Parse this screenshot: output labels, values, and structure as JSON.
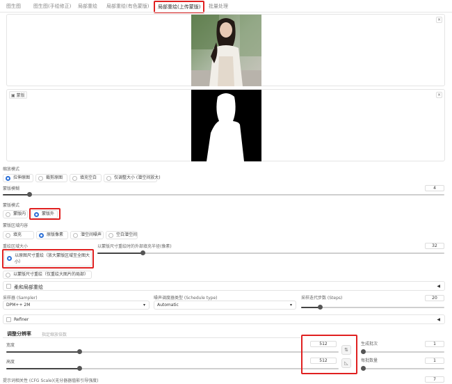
{
  "tabs": [
    "图生图",
    "图生图(手绘修正)",
    "局部重绘",
    "局部重绘(有色蒙版)",
    "局部重绘(上传蒙版)",
    "批量处理"
  ],
  "active_tab_index": 4,
  "mask_label": "蒙版",
  "close_glyph": "×",
  "resize_mode": {
    "label": "缩放模式",
    "options": [
      "拉伸原图",
      "裁剪原图",
      "填充空白",
      "仅调整大小 (潜空间放大)"
    ],
    "selected": 0
  },
  "mask_blur": {
    "label": "蒙版模糊",
    "value": "4",
    "fraction": 0.06
  },
  "mask_mode": {
    "label": "蒙版模式",
    "options": [
      "蒙版内",
      "蒙版外"
    ],
    "selected": 1
  },
  "masked_content": {
    "label": "蒙版区域内容",
    "options": [
      "填充",
      "原版像素",
      "潜空间噪声",
      "空白潜空间"
    ],
    "selected": 1
  },
  "inpaint_area": {
    "label": "重绘区域大小",
    "options": [
      "以原图尺寸重绘（放大蒙版区域至全图大小）",
      "以蒙版尺寸重绘（仅重绘大图片的局部）"
    ],
    "selected": 0
  },
  "padding": {
    "label": "以蒙版尺寸重绘时的外部填充半径(像素)",
    "value": "32",
    "fraction": 0.13
  },
  "soft_inpaint": {
    "label": "柔和局部重绘"
  },
  "sampler": {
    "label": "采样器 (Sampler)",
    "value": "DPM++ 2M"
  },
  "schedule": {
    "label": "噪声调度器类型 (Schedule type)",
    "value": "Automatic"
  },
  "steps": {
    "label": "采样迭代步数 (Steps)",
    "value": "20",
    "fraction": 0.13
  },
  "refiner": {
    "label": "Refiner"
  },
  "size_tabs": [
    "调整分辨率",
    "指定缩放倍数"
  ],
  "width": {
    "label": "宽度",
    "value": "512",
    "fraction": 0.22
  },
  "height": {
    "label": "高度",
    "value": "512",
    "fraction": 0.22
  },
  "batch_count": {
    "label": "生成批次",
    "value": "1",
    "fraction": 0.0
  },
  "batch_size": {
    "label": "每批数量",
    "value": "1",
    "fraction": 0.0
  },
  "cfg": {
    "label": "提示词相关性 (CFG Scale)(无分器器值影引导强度)",
    "value": "7"
  },
  "icons": {
    "swap": "⇅",
    "ratio": "◺",
    "collapse": "◀",
    "dropdown": "▾"
  }
}
